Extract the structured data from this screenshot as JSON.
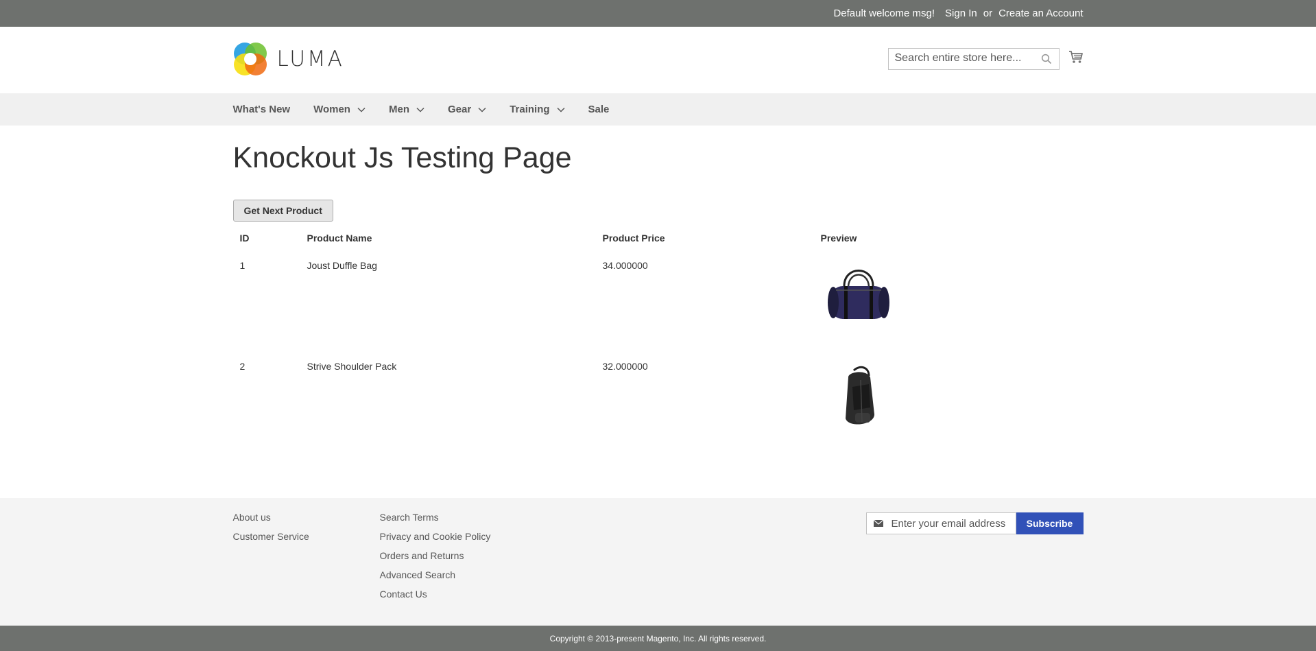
{
  "header_panel": {
    "welcome": "Default welcome msg!",
    "sign_in": "Sign In",
    "or": "or",
    "create_account": "Create an Account"
  },
  "logo": {
    "text": "LUMA"
  },
  "search": {
    "placeholder": "Search entire store here..."
  },
  "nav": {
    "items": [
      {
        "label": "What's New",
        "has_dropdown": false
      },
      {
        "label": "Women",
        "has_dropdown": true
      },
      {
        "label": "Men",
        "has_dropdown": true
      },
      {
        "label": "Gear",
        "has_dropdown": true
      },
      {
        "label": "Training",
        "has_dropdown": true
      },
      {
        "label": "Sale",
        "has_dropdown": false
      }
    ]
  },
  "page": {
    "title": "Knockout Js Testing Page",
    "next_button": "Get Next Product",
    "table": {
      "headers": [
        "ID",
        "Product Name",
        "Product Price",
        "Preview"
      ],
      "rows": [
        {
          "id": "1",
          "name": "Joust Duffle Bag",
          "price": "34.000000",
          "preview": "duffle-bag-image"
        },
        {
          "id": "2",
          "name": "Strive Shoulder Pack",
          "price": "32.000000",
          "preview": "shoulder-pack-image"
        }
      ]
    }
  },
  "footer": {
    "col1": [
      "About us",
      "Customer Service"
    ],
    "col2": [
      "Search Terms",
      "Privacy and Cookie Policy",
      "Orders and Returns",
      "Advanced Search",
      "Contact Us"
    ],
    "newsletter": {
      "placeholder": "Enter your email address",
      "button": "Subscribe"
    }
  },
  "copyright": "Copyright © 2013-present Magento, Inc. All rights reserved.",
  "colors": {
    "top_bar": "#6e716e",
    "nav_bg": "#f0f0f0",
    "subscribe": "#3151b8",
    "footer_bg": "#f4f4f4"
  }
}
